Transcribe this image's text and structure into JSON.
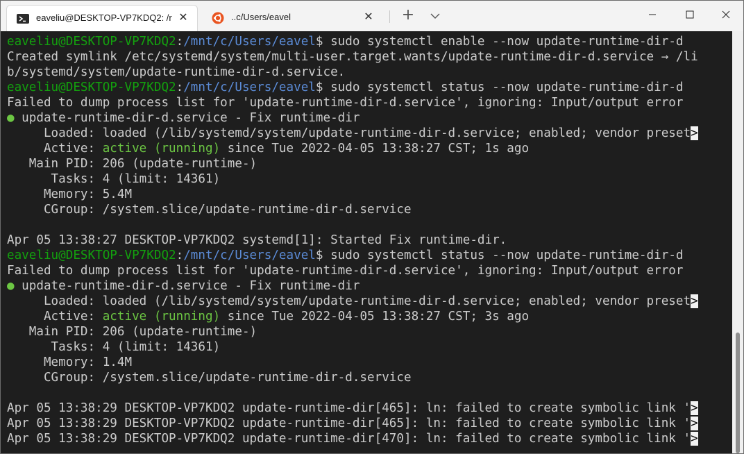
{
  "tabs": [
    {
      "title": "eaveliu@DESKTOP-VP7KDQ2: /r",
      "close": "✕",
      "icon": "powershell-icon"
    },
    {
      "title": "..c/Users/eavel",
      "close": "✕",
      "icon": "ubuntu-icon"
    }
  ],
  "tabbar": {
    "new_tab": "+",
    "dropdown": "chevron-down-icon"
  },
  "window_controls": {
    "minimize": "minimize-icon",
    "maximize": "maximize-icon",
    "close": "close-icon"
  },
  "colors": {
    "prompt_user": "#13a10e",
    "prompt_path": "#5b8bd6",
    "active": "#6cc643",
    "dot": "#6cc643",
    "text": "#cccccc",
    "background": "#1e1e1e"
  },
  "terminal": {
    "lines": [
      {
        "user": "eaveliu@DESKTOP-VP7KDQ2",
        "sep": ":",
        "path": "/mnt/c/Users/eavel",
        "cmd": "$ sudo systemctl enable --now update-runtime-dir-d"
      },
      {
        "text": "Created symlink /etc/systemd/system/multi-user.target.wants/update-runtime-dir-d.service → /li"
      },
      {
        "text": "b/systemd/system/update-runtime-dir-d.service."
      },
      {
        "user": "eaveliu@DESKTOP-VP7KDQ2",
        "sep": ":",
        "path": "/mnt/c/Users/eavel",
        "cmd": "$ sudo systemctl status --now update-runtime-dir-d"
      },
      {
        "text": "Failed to dump process list for 'update-runtime-dir-d.service', ignoring: Input/output error"
      },
      {
        "dot": "●",
        "text": " update-runtime-dir-d.service - Fix runtime-dir"
      },
      {
        "text": "     Loaded: loaded (/lib/systemd/system/update-runtime-dir-d.service; enabled; vendor preset",
        "more": ">"
      },
      {
        "pre": "     Active: ",
        "active": "active (running)",
        "post": " since Tue 2022-04-05 13:38:27 CST; 1s ago"
      },
      {
        "text": "   Main PID: 206 (update-runtime-)"
      },
      {
        "text": "      Tasks: 4 (limit: 14361)"
      },
      {
        "text": "     Memory: 5.4M"
      },
      {
        "text": "     CGroup: /system.slice/update-runtime-dir-d.service"
      },
      {
        "text": ""
      },
      {
        "text": "Apr 05 13:38:27 DESKTOP-VP7KDQ2 systemd[1]: Started Fix runtime-dir."
      },
      {
        "user": "eaveliu@DESKTOP-VP7KDQ2",
        "sep": ":",
        "path": "/mnt/c/Users/eavel",
        "cmd": "$ sudo systemctl status --now update-runtime-dir-d"
      },
      {
        "text": "Failed to dump process list for 'update-runtime-dir-d.service', ignoring: Input/output error"
      },
      {
        "dot": "●",
        "text": " update-runtime-dir-d.service - Fix runtime-dir"
      },
      {
        "text": "     Loaded: loaded (/lib/systemd/system/update-runtime-dir-d.service; enabled; vendor preset",
        "more": ">"
      },
      {
        "pre": "     Active: ",
        "active": "active (running)",
        "post": " since Tue 2022-04-05 13:38:27 CST; 3s ago"
      },
      {
        "text": "   Main PID: 206 (update-runtime-)"
      },
      {
        "text": "      Tasks: 4 (limit: 14361)"
      },
      {
        "text": "     Memory: 1.4M"
      },
      {
        "text": "     CGroup: /system.slice/update-runtime-dir-d.service"
      },
      {
        "text": ""
      },
      {
        "text": "Apr 05 13:38:29 DESKTOP-VP7KDQ2 update-runtime-dir[465]: ln: failed to create symbolic link '",
        "more": ">"
      },
      {
        "text": "Apr 05 13:38:29 DESKTOP-VP7KDQ2 update-runtime-dir[465]: ln: failed to create symbolic link '",
        "more": ">"
      },
      {
        "text": "Apr 05 13:38:29 DESKTOP-VP7KDQ2 update-runtime-dir[470]: ln: failed to create symbolic link '",
        "more": ">"
      }
    ]
  }
}
